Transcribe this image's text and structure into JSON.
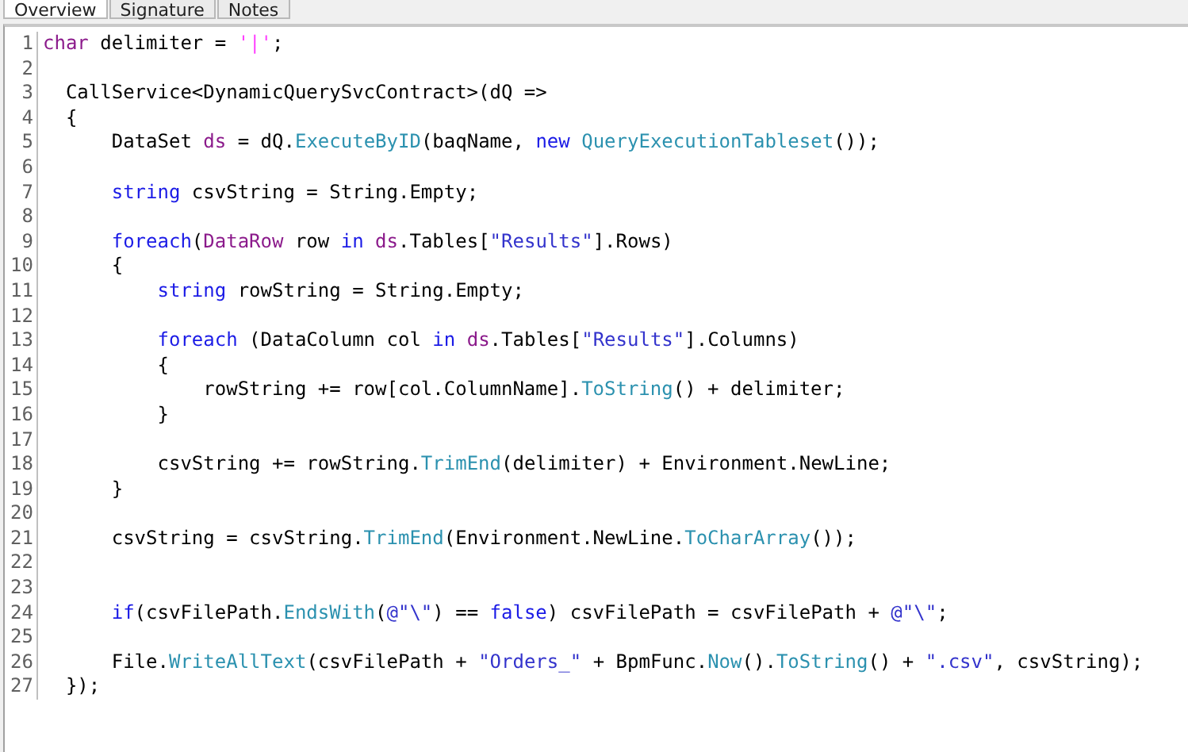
{
  "tabs": [
    {
      "label": "Overview",
      "selected": true
    },
    {
      "label": "Signature",
      "selected": false
    },
    {
      "label": "Notes",
      "selected": false
    }
  ],
  "editor": {
    "lines": [
      {
        "number": "1",
        "tokens": [
          {
            "kind": "type",
            "text": "char"
          },
          {
            "kind": "plain",
            "text": " delimiter = "
          },
          {
            "kind": "char",
            "text": "'|'"
          },
          {
            "kind": "plain",
            "text": ";"
          }
        ]
      },
      {
        "number": "2"
      },
      {
        "number": "3",
        "tokens": [
          {
            "kind": "plain",
            "text": "  CallService<DynamicQuerySvcContract>(dQ =>"
          }
        ]
      },
      {
        "number": "4",
        "tokens": [
          {
            "kind": "plain",
            "text": "  {"
          }
        ]
      },
      {
        "number": "5",
        "tokens": [
          {
            "kind": "plain",
            "text": "      DataSet "
          },
          {
            "kind": "type",
            "text": "ds"
          },
          {
            "kind": "plain",
            "text": " = dQ."
          },
          {
            "kind": "method",
            "text": "ExecuteByID"
          },
          {
            "kind": "plain",
            "text": "(baqName, "
          },
          {
            "kind": "keyword",
            "text": "new "
          },
          {
            "kind": "method",
            "text": "QueryExecutionTableset"
          },
          {
            "kind": "plain",
            "text": "());"
          }
        ]
      },
      {
        "number": "6"
      },
      {
        "number": "7",
        "tokens": [
          {
            "kind": "keyword",
            "text": "      string"
          },
          {
            "kind": "plain",
            "text": " csvString = String.Empty;"
          }
        ]
      },
      {
        "number": "8"
      },
      {
        "number": "9",
        "tokens": [
          {
            "kind": "keyword",
            "text": "      foreach"
          },
          {
            "kind": "plain",
            "text": "("
          },
          {
            "kind": "type",
            "text": "DataRow"
          },
          {
            "kind": "plain",
            "text": " row "
          },
          {
            "kind": "keyword",
            "text": "in "
          },
          {
            "kind": "type",
            "text": "ds"
          },
          {
            "kind": "plain",
            "text": ".Tables["
          },
          {
            "kind": "string",
            "text": "\"Results\""
          },
          {
            "kind": "plain",
            "text": "].Rows)"
          }
        ]
      },
      {
        "number": "10",
        "tokens": [
          {
            "kind": "plain",
            "text": "      {"
          }
        ]
      },
      {
        "number": "11",
        "tokens": [
          {
            "kind": "keyword",
            "text": "          string"
          },
          {
            "kind": "plain",
            "text": " rowString = String.Empty;"
          }
        ]
      },
      {
        "number": "12"
      },
      {
        "number": "13",
        "tokens": [
          {
            "kind": "keyword",
            "text": "          foreach"
          },
          {
            "kind": "plain",
            "text": " (DataColumn col "
          },
          {
            "kind": "keyword",
            "text": "in "
          },
          {
            "kind": "type",
            "text": "ds"
          },
          {
            "kind": "plain",
            "text": ".Tables["
          },
          {
            "kind": "string",
            "text": "\"Results\""
          },
          {
            "kind": "plain",
            "text": "].Columns)"
          }
        ]
      },
      {
        "number": "14",
        "tokens": [
          {
            "kind": "plain",
            "text": "          {"
          }
        ]
      },
      {
        "number": "15",
        "tokens": [
          {
            "kind": "plain",
            "text": "              rowString += row[col.ColumnName]."
          },
          {
            "kind": "method",
            "text": "ToString"
          },
          {
            "kind": "plain",
            "text": "() + delimiter;"
          }
        ]
      },
      {
        "number": "16",
        "tokens": [
          {
            "kind": "plain",
            "text": "          }"
          }
        ]
      },
      {
        "number": "17"
      },
      {
        "number": "18",
        "tokens": [
          {
            "kind": "plain",
            "text": "          csvString += rowString."
          },
          {
            "kind": "method",
            "text": "TrimEnd"
          },
          {
            "kind": "plain",
            "text": "(delimiter) + Environment.NewLine;"
          }
        ]
      },
      {
        "number": "19",
        "tokens": [
          {
            "kind": "plain",
            "text": "      }"
          }
        ]
      },
      {
        "number": "20"
      },
      {
        "number": "21",
        "tokens": [
          {
            "kind": "plain",
            "text": "      csvString = csvString."
          },
          {
            "kind": "method",
            "text": "TrimEnd"
          },
          {
            "kind": "plain",
            "text": "(Environment.NewLine."
          },
          {
            "kind": "method",
            "text": "ToCharArray"
          },
          {
            "kind": "plain",
            "text": "());"
          }
        ]
      },
      {
        "number": "22"
      },
      {
        "number": "23"
      },
      {
        "number": "24",
        "tokens": [
          {
            "kind": "keyword",
            "text": "      if"
          },
          {
            "kind": "plain",
            "text": "(csvFilePath."
          },
          {
            "kind": "method",
            "text": "EndsWith"
          },
          {
            "kind": "plain",
            "text": "("
          },
          {
            "kind": "string",
            "text": "@\"\\\""
          },
          {
            "kind": "plain",
            "text": ") == "
          },
          {
            "kind": "keyword",
            "text": "false"
          },
          {
            "kind": "plain",
            "text": ") csvFilePath = csvFilePath + "
          },
          {
            "kind": "string",
            "text": "@\"\\\""
          },
          {
            "kind": "plain",
            "text": ";"
          }
        ]
      },
      {
        "number": "25"
      },
      {
        "number": "26",
        "tokens": [
          {
            "kind": "plain",
            "text": "      File."
          },
          {
            "kind": "method",
            "text": "WriteAllText"
          },
          {
            "kind": "plain",
            "text": "(csvFilePath + "
          },
          {
            "kind": "string",
            "text": "\"Orders_\""
          },
          {
            "kind": "plain",
            "text": " + BpmFunc."
          },
          {
            "kind": "method",
            "text": "Now"
          },
          {
            "kind": "plain",
            "text": "()."
          },
          {
            "kind": "method",
            "text": "ToString"
          },
          {
            "kind": "plain",
            "text": "() + "
          },
          {
            "kind": "string",
            "text": "\".csv\""
          },
          {
            "kind": "plain",
            "text": ", csvString);"
          }
        ]
      },
      {
        "number": "27",
        "tokens": [
          {
            "kind": "plain",
            "text": "  });"
          }
        ]
      }
    ]
  }
}
